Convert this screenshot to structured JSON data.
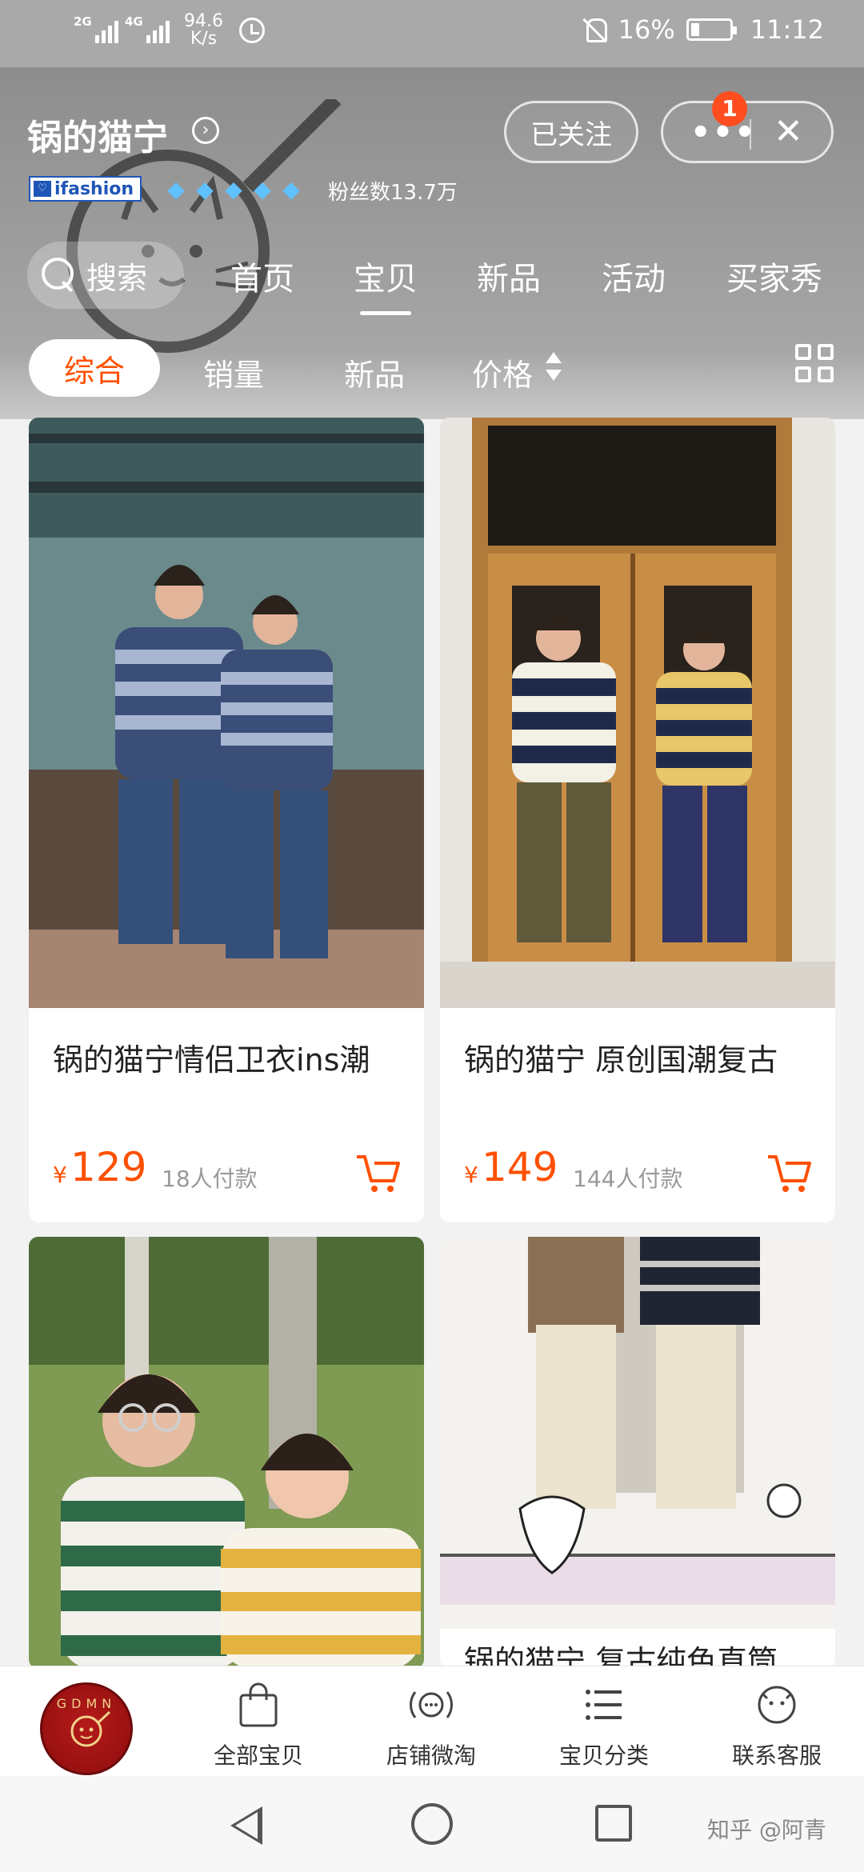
{
  "status_bar": {
    "signal1_tag": "2G",
    "signal2_tag": "4G",
    "net_speed_value": "94.6",
    "net_speed_unit": "K/s",
    "battery": "16%",
    "time": "11:12"
  },
  "shop": {
    "name": "锅的猫宁",
    "name_arrow": "›",
    "ifashion_label": "ifashion",
    "diamond_count": 5,
    "fans": "粉丝数13.7万",
    "follow_label": "已关注",
    "menu_dots": "•••",
    "close_label": "✕",
    "notification_badge": "1"
  },
  "nav": {
    "search_label": "搜索",
    "tabs": [
      "首页",
      "宝贝",
      "新品",
      "活动",
      "买家秀"
    ],
    "active_tab": "宝贝"
  },
  "sort": {
    "options": [
      "综合",
      "销量",
      "新品",
      "价格"
    ],
    "active": "综合"
  },
  "products": [
    {
      "title": "锅的猫宁情侣卫衣ins潮",
      "currency": "¥",
      "price": "129",
      "sold": "18人付款"
    },
    {
      "title": "锅的猫宁 原创国潮复古",
      "currency": "¥",
      "price": "149",
      "sold": "144人付款"
    },
    {
      "title": "",
      "currency": "",
      "price": "",
      "sold": ""
    },
    {
      "title": "锅的猫宁 复古纯色直筒",
      "currency": "",
      "price": "",
      "sold": ""
    }
  ],
  "bottom_bar": {
    "logo_text": "GDMN",
    "items": [
      "全部宝贝",
      "店铺微淘",
      "宝贝分类",
      "联系客服"
    ]
  },
  "watermark": "知乎 @阿青",
  "colors": {
    "accent": "#ff5000",
    "header_bg": "#9b9b9b",
    "badge": "#ff4d1f",
    "diamond": "#5fc1ff",
    "ifashion_blue": "#1e55b8"
  },
  "icons": {
    "search": "search-icon",
    "cart": "cart-icon",
    "close": "close-icon",
    "more": "more-dots-icon",
    "grid": "grid-view-icon"
  }
}
